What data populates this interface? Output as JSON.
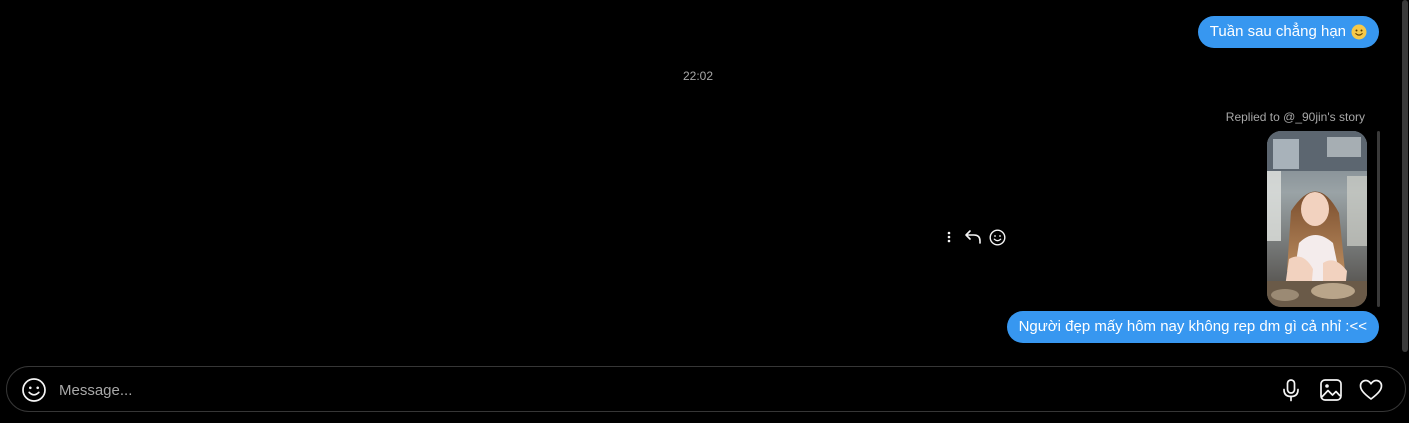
{
  "messages": [
    {
      "text": "Tuần sau chẳng hạn",
      "emoji": "slightly-smiling-face-emoji"
    },
    {
      "text": "Người đẹp mấy hôm nay không rep dm gì cả nhỉ :<<"
    }
  ],
  "timestamp": "22:02",
  "story_reply": {
    "label": "Replied to @_90jin's story"
  },
  "message_actions": [
    "more-icon",
    "reply-icon",
    "react-icon"
  ],
  "composer": {
    "placeholder": "Message...",
    "icons": [
      "emoji-icon",
      "microphone-icon",
      "image-icon",
      "heart-icon"
    ]
  },
  "colors": {
    "background": "#000000",
    "bubble": "#3797f0",
    "muted_text": "#a8a8a8",
    "border": "#363636"
  }
}
